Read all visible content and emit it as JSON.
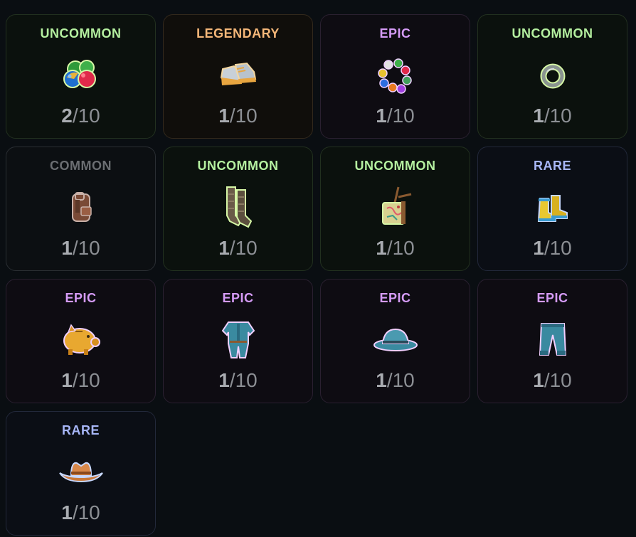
{
  "colors": {
    "uncommon": "#b5f0a0",
    "legendary": "#f5b779",
    "epic": "#d59bf6",
    "common": "#6b6e72",
    "rare": "#a7b6f7"
  },
  "items": [
    {
      "rarity": "UNCOMMON",
      "rarity_key": "uncommon",
      "icon": "juggling-balls-icon",
      "owned": "2",
      "max": "10"
    },
    {
      "rarity": "LEGENDARY",
      "rarity_key": "legendary",
      "icon": "sneakers-icon",
      "owned": "1",
      "max": "10"
    },
    {
      "rarity": "EPIC",
      "rarity_key": "epic",
      "icon": "gem-bracelet-icon",
      "owned": "1",
      "max": "10"
    },
    {
      "rarity": "UNCOMMON",
      "rarity_key": "uncommon",
      "icon": "ring-icon",
      "owned": "1",
      "max": "10"
    },
    {
      "rarity": "COMMON",
      "rarity_key": "common",
      "icon": "backpack-icon",
      "owned": "1",
      "max": "10"
    },
    {
      "rarity": "UNCOMMON",
      "rarity_key": "uncommon",
      "icon": "socks-icon",
      "owned": "1",
      "max": "10"
    },
    {
      "rarity": "UNCOMMON",
      "rarity_key": "uncommon",
      "icon": "map-bag-icon",
      "owned": "1",
      "max": "10"
    },
    {
      "rarity": "RARE",
      "rarity_key": "rare",
      "icon": "boots-icon",
      "owned": "1",
      "max": "10"
    },
    {
      "rarity": "EPIC",
      "rarity_key": "epic",
      "icon": "piggy-bank-icon",
      "owned": "1",
      "max": "10"
    },
    {
      "rarity": "EPIC",
      "rarity_key": "epic",
      "icon": "overalls-icon",
      "owned": "1",
      "max": "10"
    },
    {
      "rarity": "EPIC",
      "rarity_key": "epic",
      "icon": "bucket-hat-icon",
      "owned": "1",
      "max": "10"
    },
    {
      "rarity": "EPIC",
      "rarity_key": "epic",
      "icon": "pants-icon",
      "owned": "1",
      "max": "10"
    },
    {
      "rarity": "RARE",
      "rarity_key": "rare",
      "icon": "cowboy-hat-icon",
      "owned": "1",
      "max": "10"
    }
  ],
  "slash": "/"
}
